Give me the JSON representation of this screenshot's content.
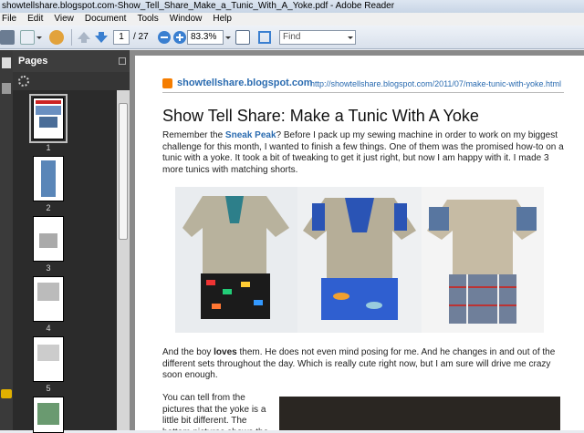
{
  "window": {
    "title": "showtellshare.blogspot.com-Show_Tell_Share_Make_a_Tunic_With_A_Yoke.pdf - Adobe Reader"
  },
  "menu": [
    "File",
    "Edit",
    "View",
    "Document",
    "Tools",
    "Window",
    "Help"
  ],
  "toolbar": {
    "page_number": "1",
    "page_total": "/ 27",
    "zoom": "83.3%",
    "find_placeholder": "Find"
  },
  "sidebar": {
    "title": "Pages",
    "thumbnails": [
      {
        "label": "1",
        "selected": true
      },
      {
        "label": "2"
      },
      {
        "label": "3"
      },
      {
        "label": "4"
      },
      {
        "label": "5"
      },
      {
        "label": ""
      }
    ]
  },
  "document": {
    "blog_name": "showtellshare.blogspot.com",
    "blog_url": "http://showtellshare.blogspot.com/2011/07/make-tunic-with-yoke.html",
    "title": "Show Tell Share: Make a Tunic With A Yoke",
    "para1": {
      "before": "Remember the ",
      "link": "Sneak Peak",
      "after": "? Before I pack up my sewing machine in order to work on my biggest challenge for this month, I wanted to finish a few things. One of them was the promised how-to on a tunic with a yoke. It took a bit of tweaking to get it just right, but now I am happy with it. I made 3 more tunics with matching shorts."
    },
    "para2": {
      "before": "And the boy ",
      "bold": "loves",
      "after": " them. He does not even mind posing for me. And he changes in and out of the different sets throughout the day. Which is really cute right now, but I am sure will drive me crazy soon enough."
    },
    "para3": "You can tell from the pictures that the yoke is a little bit different. The bottom pictures shows the"
  },
  "colors": {
    "link": "#2a6bb0",
    "blogger_orange": "#f57d00",
    "thumb_selected": "#c0c0c0"
  }
}
